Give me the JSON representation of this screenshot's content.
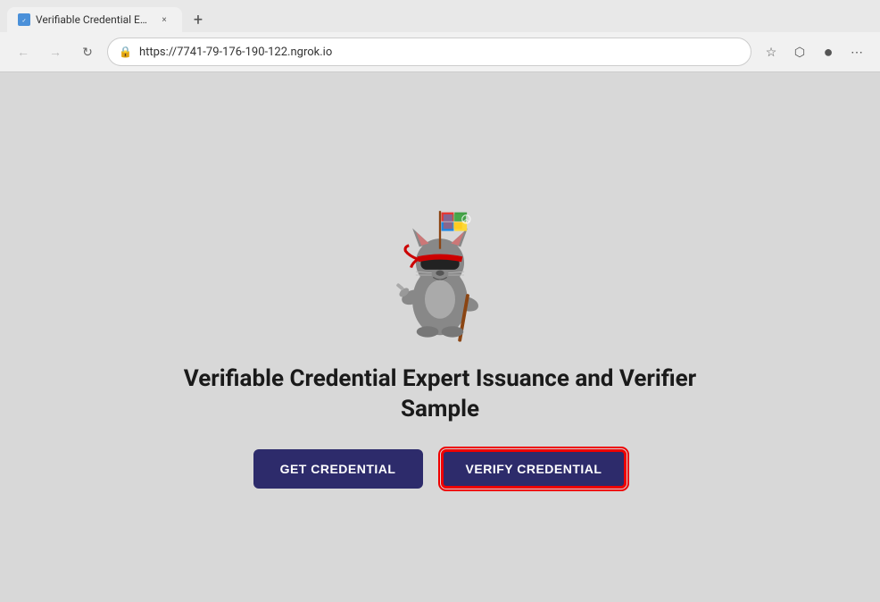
{
  "browser": {
    "tab_title": "Verifiable Credential Expert Ch",
    "tab_close_label": "×",
    "new_tab_label": "+",
    "url": "https://7741-79-176-190-122.ngrok.io",
    "back_icon": "←",
    "forward_icon": "→",
    "refresh_icon": "↻",
    "lock_icon": "🔒",
    "star_icon": "☆",
    "bookmark_icon": "⬡",
    "profile_icon": "●",
    "more_icon": "⋯"
  },
  "page": {
    "title": "Verifiable Credential Expert Issuance and Verifier Sample",
    "get_credential_label": "GET CREDENTIAL",
    "verify_credential_label": "VERIFY CREDENTIAL"
  }
}
